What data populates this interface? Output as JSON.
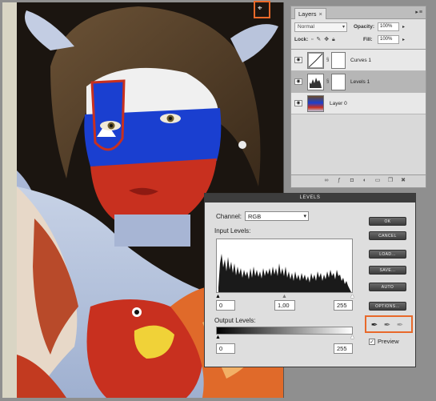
{
  "layers_panel": {
    "tab_label": "Layers",
    "tab_close": "×",
    "panel_menu": "▸≡",
    "blend_mode": "Normal",
    "opacity_label": "Opacity:",
    "opacity_value": "100%",
    "lock_label": "Lock:",
    "fill_label": "Fill:",
    "fill_value": "100%",
    "layers": [
      {
        "name": "Curves 1",
        "visible": true,
        "selected": false
      },
      {
        "name": "Levels 1",
        "visible": true,
        "selected": true
      },
      {
        "name": "Layer 0",
        "visible": true,
        "selected": false
      }
    ],
    "footer_icons": [
      "link-icon",
      "fx-icon",
      "mask-icon",
      "adjustment-icon",
      "group-icon",
      "new-layer-icon",
      "trash-icon"
    ]
  },
  "levels_dialog": {
    "title": "LEVELS",
    "channel_label": "Channel:",
    "channel_value": "RGB",
    "input_levels_label": "Input Levels:",
    "input_black": "0",
    "input_gamma": "1,00",
    "input_white": "255",
    "output_levels_label": "Output Levels:",
    "output_black": "0",
    "output_white": "255",
    "buttons": {
      "ok": "OK",
      "cancel": "CANCEL",
      "load": "LOAD...",
      "save": "SAVE...",
      "auto": "AUTO",
      "options": "OPTIONS..."
    },
    "preview_label": "Preview",
    "preview_checked": true
  },
  "colors": {
    "highlight": "#e8692a",
    "dialog_bg": "#dedede",
    "button_dark": "#3e3e3e"
  }
}
